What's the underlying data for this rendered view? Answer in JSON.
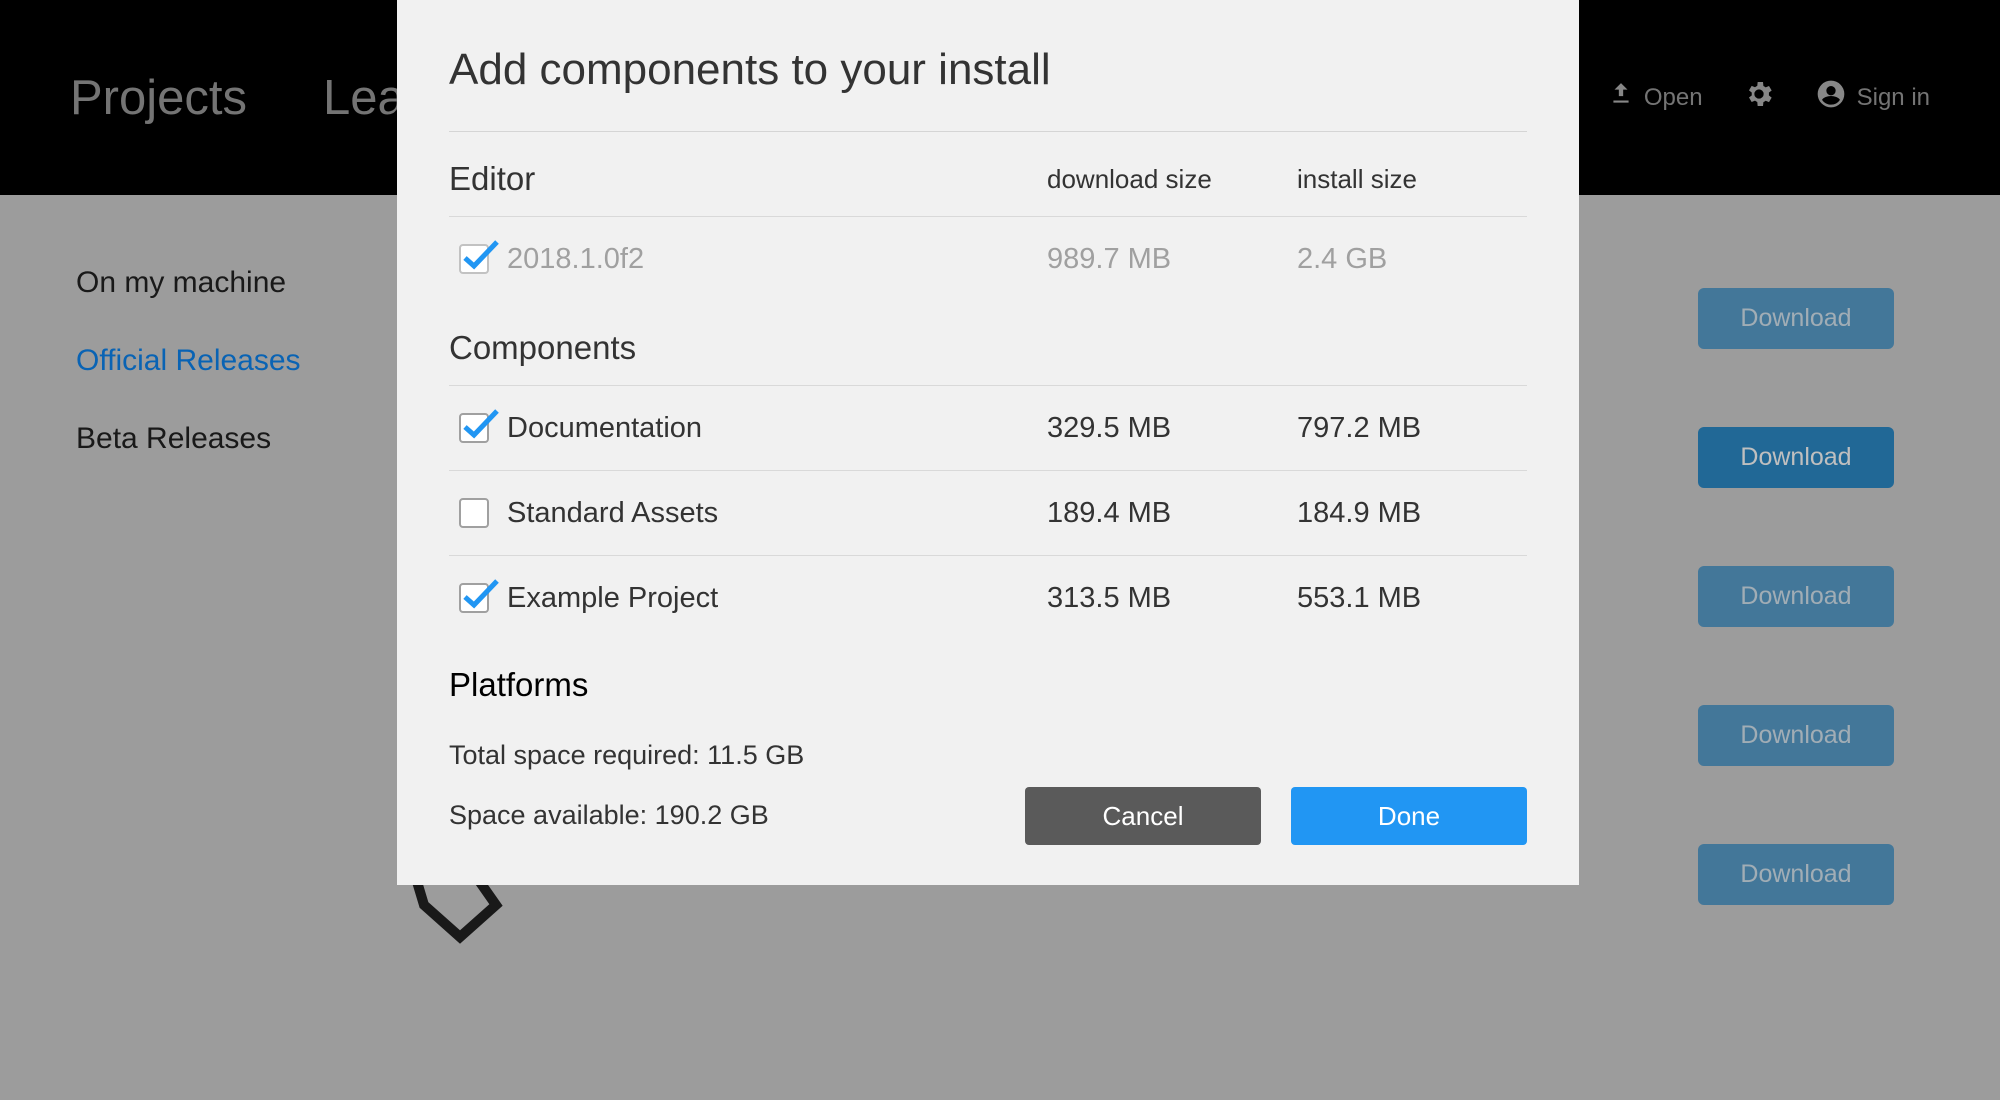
{
  "header": {
    "tabs": [
      "Projects",
      "Learn"
    ],
    "open_label": "Open",
    "sign_in_label": "Sign in"
  },
  "sidebar": {
    "items": [
      {
        "label": "On my machine",
        "active": false
      },
      {
        "label": "Official Releases",
        "active": true
      },
      {
        "label": "Beta Releases",
        "active": false
      }
    ]
  },
  "downloads": {
    "label": "Download",
    "count": 5
  },
  "modal": {
    "title": "Add components to your install",
    "cols": {
      "download": "download size",
      "install": "install size"
    },
    "sections": {
      "editor": {
        "title": "Editor",
        "items": [
          {
            "label": "2018.1.0f2",
            "download": "989.7 MB",
            "install": "2.4 GB",
            "checked": true,
            "disabled": true
          }
        ]
      },
      "components": {
        "title": "Components",
        "items": [
          {
            "label": "Documentation",
            "download": "329.5 MB",
            "install": "797.2 MB",
            "checked": true,
            "disabled": false
          },
          {
            "label": "Standard Assets",
            "download": "189.4 MB",
            "install": "184.9 MB",
            "checked": false,
            "disabled": false
          },
          {
            "label": "Example Project",
            "download": "313.5 MB",
            "install": "553.1 MB",
            "checked": true,
            "disabled": false
          }
        ]
      },
      "platforms": {
        "title": "Platforms"
      }
    },
    "disk": {
      "required_label": "Total space required:",
      "required_value": "11.5 GB",
      "available_label": "Space available:",
      "available_value": "190.2 GB"
    },
    "buttons": {
      "cancel": "Cancel",
      "done": "Done"
    }
  }
}
